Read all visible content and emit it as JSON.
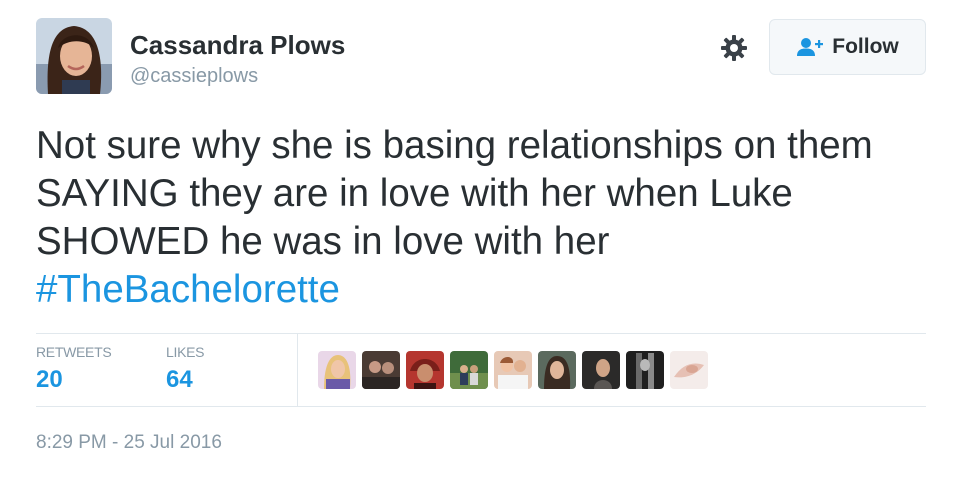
{
  "author": {
    "display_name": "Cassandra Plows",
    "handle": "@cassieplows"
  },
  "actions": {
    "follow_label": "Follow",
    "settings_icon": "gear-icon",
    "follow_icon": "add-user-icon"
  },
  "tweet": {
    "lines": [
      "Not sure why she is basing relationships on them",
      "SAYING they are in love with her when Luke",
      "SHOWED he was in love with her"
    ],
    "hashtag": "#TheBachelorette"
  },
  "stats": {
    "retweets_label": "RETWEETS",
    "retweets_value": "20",
    "likes_label": "LIKES",
    "likes_value": "64"
  },
  "timestamp": "8:29 PM - 25 Jul 2016",
  "colors": {
    "link": "#1b95e0",
    "text": "#292f33",
    "muted": "#8899a6",
    "border": "#e1e8ed"
  }
}
